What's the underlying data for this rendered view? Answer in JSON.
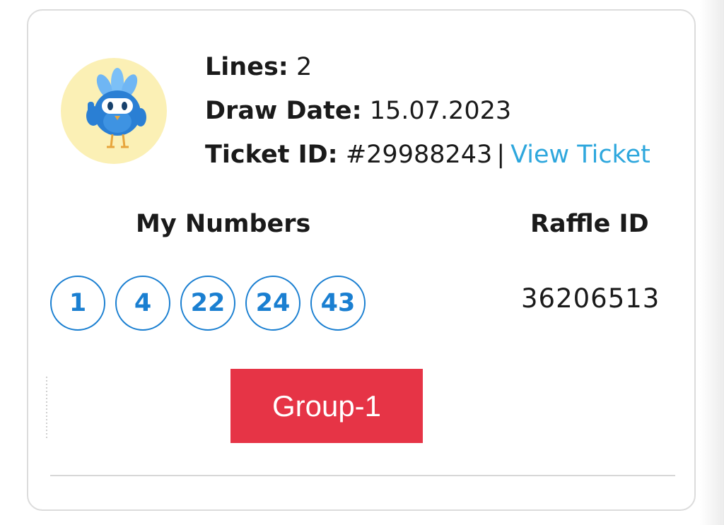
{
  "ticket": {
    "lines_label": "Lines:",
    "lines_value": "2",
    "draw_date_label": "Draw Date:",
    "draw_date_value": "15.07.2023",
    "ticket_id_label": "Ticket ID:",
    "ticket_id_value": "#29988243",
    "separator": "|",
    "view_ticket_label": "View Ticket"
  },
  "columns": {
    "my_numbers_label": "My Numbers",
    "raffle_id_label": "Raffle ID"
  },
  "numbers": [
    "1",
    "4",
    "22",
    "24",
    "43"
  ],
  "raffle_id": "36206513",
  "group_button_label": "Group-1",
  "colors": {
    "accent_blue": "#1a7fd1",
    "link_blue": "#2ea7dd",
    "group_red": "#e63446",
    "avatar_bg": "#fbf0b5"
  },
  "icons": {
    "avatar": "mascot-bird-icon"
  }
}
